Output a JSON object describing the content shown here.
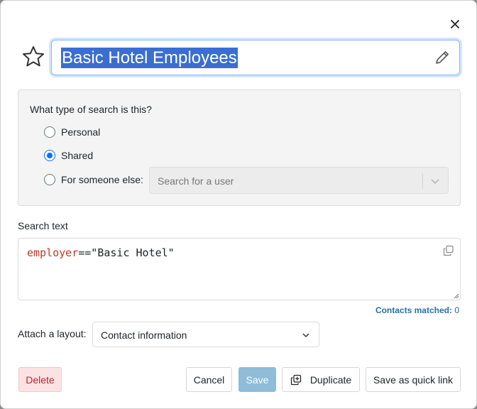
{
  "dialog": {
    "title": "Basic Hotel Employees"
  },
  "search_type": {
    "question": "What type of search is this?",
    "options": [
      {
        "label": "Personal",
        "checked": false
      },
      {
        "label": "Shared",
        "checked": true
      },
      {
        "label": "For someone else:",
        "checked": false
      }
    ],
    "user_search_placeholder": "Search for a user"
  },
  "search_text": {
    "label": "Search text",
    "code_key": "employer",
    "code_rest": "==\"Basic Hotel\""
  },
  "contacts": {
    "label": "Contacts matched:",
    "count": "0"
  },
  "layout": {
    "label": "Attach a layout:",
    "selected": "Contact information"
  },
  "buttons": {
    "delete": "Delete",
    "cancel": "Cancel",
    "save": "Save",
    "duplicate": "Duplicate",
    "quick_link": "Save as quick link"
  },
  "colors": {
    "accent": "#0d6efd",
    "selection": "#3a6ed0",
    "danger_text": "#b02a37",
    "save_disabled": "#8fbcd8"
  },
  "icons": {
    "close": "close-icon",
    "star": "star-icon",
    "edit": "pencil-icon",
    "copy": "copy-icon",
    "duplicate": "duplicate-icon",
    "dropdown": "chevron-down-icon"
  }
}
